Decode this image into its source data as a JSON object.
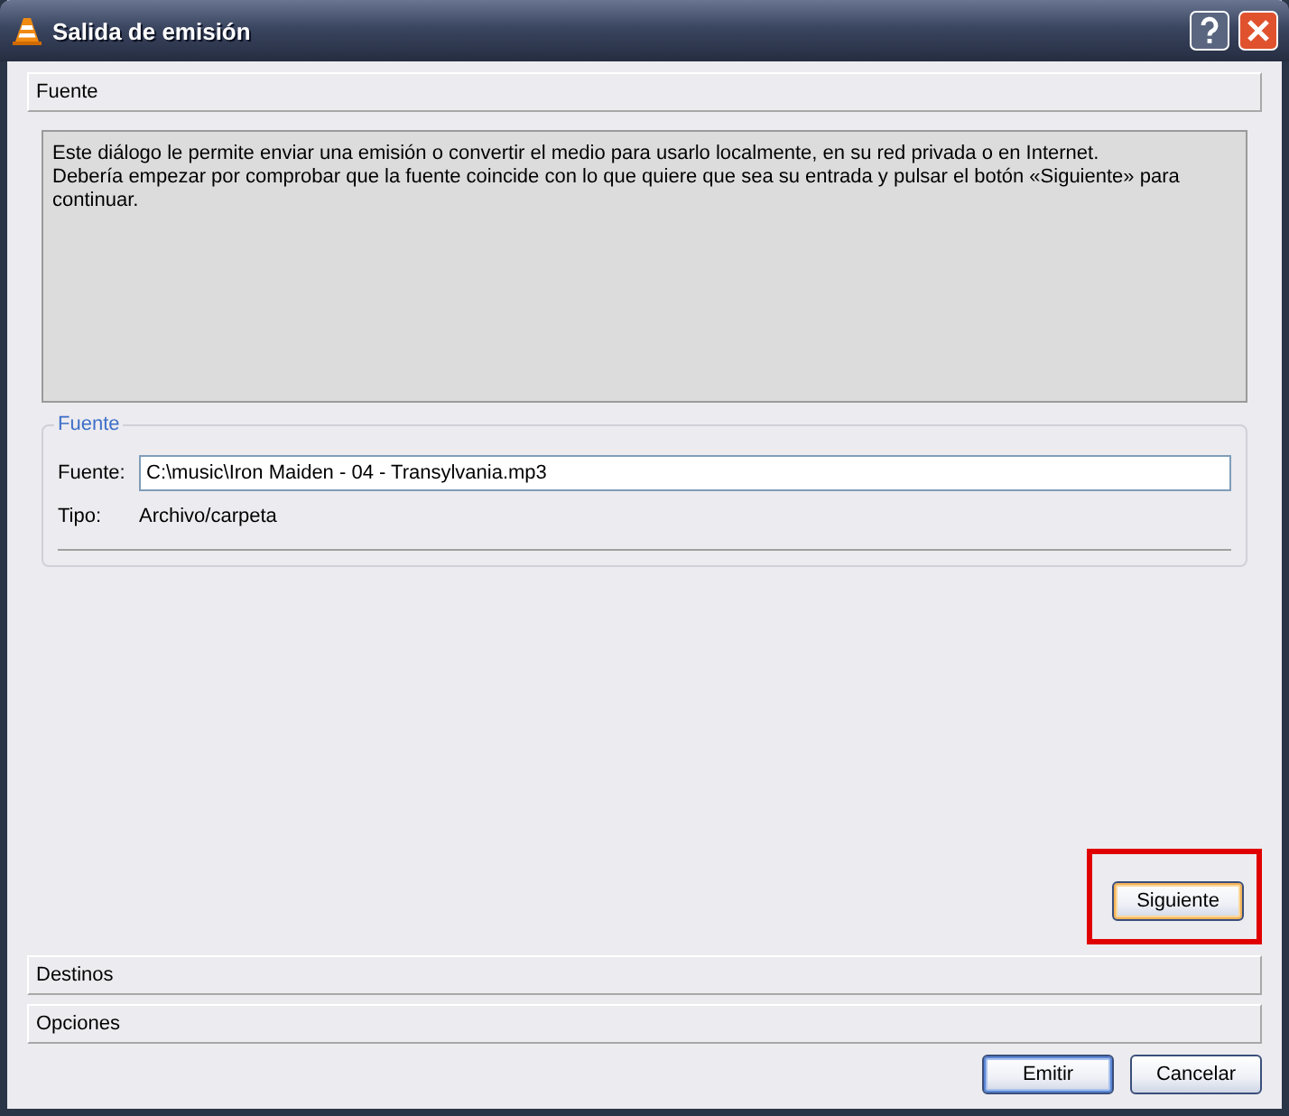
{
  "window": {
    "title": "Salida de emisión"
  },
  "sections": [
    {
      "title": "Fuente",
      "page": {
        "description": [
          "Este diálogo le permite enviar una emisión o convertir el medio para usarlo localmente, en su red privada o en Internet.",
          "Debería empezar por comprobar que la fuente coincide con lo que quiere que sea su entrada y pulsar el botón «Siguiente» para continuar."
        ],
        "source_group": {
          "title": "Fuente",
          "fields": [
            {
              "kind": "input",
              "label": "Fuente:",
              "value": "C:\\music\\Iron Maiden - 04 - Transylvania.mp3"
            },
            {
              "kind": "text",
              "label": "Tipo:",
              "value": "Archivo/carpeta"
            }
          ]
        },
        "next_button": {
          "label": "Siguiente",
          "highlighted": true
        }
      }
    },
    {
      "title": "Destinos"
    },
    {
      "title": "Opciones"
    }
  ],
  "buttons": [
    {
      "label": "Emitir",
      "default": true
    },
    {
      "label": "Cancelar",
      "default": false
    }
  ]
}
